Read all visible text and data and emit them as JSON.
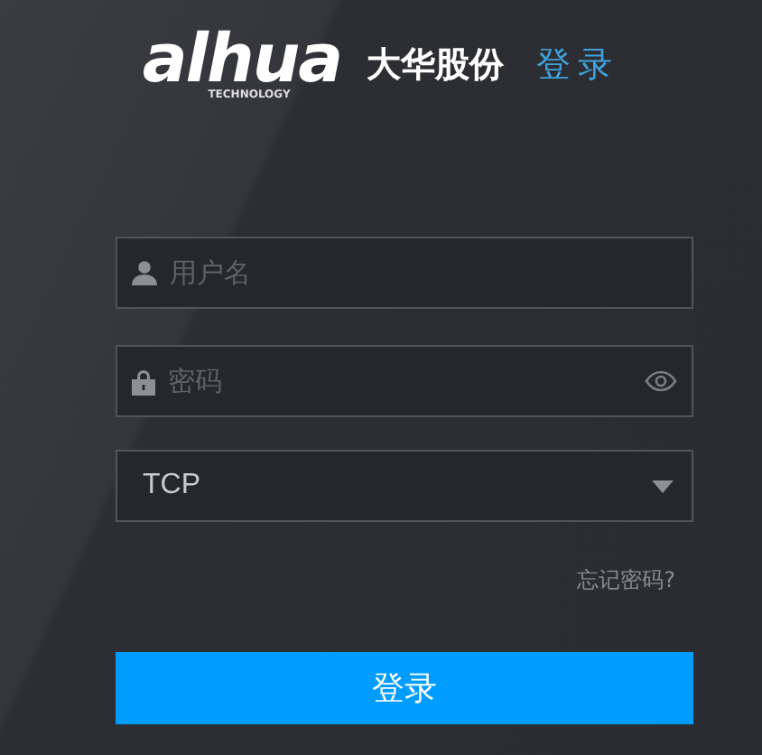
{
  "header": {
    "logo_text": "alhua",
    "logo_subtitle": "TECHNOLOGY",
    "company": "大华股份",
    "title": "登录"
  },
  "fields": [
    {
      "kind": "username",
      "placeholder": "用户名"
    },
    {
      "kind": "password",
      "placeholder": "密码"
    },
    {
      "kind": "select",
      "value": "TCP"
    }
  ],
  "forgot_link": "忘记密码?",
  "login_button": "登录"
}
